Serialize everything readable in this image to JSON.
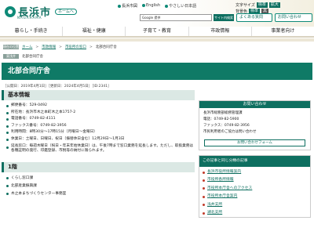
{
  "header": {
    "site_name": "長浜市",
    "site_sub": "NAGAHAMA",
    "home_label": "ホームへ",
    "top_links": [
      "長浜市図",
      "English",
      "やさしい日本語"
    ],
    "text_size_label": "文字サイズ",
    "size_buttons": [
      "標準",
      "拡大"
    ],
    "color_label": "背景色",
    "color_buttons": [
      "標準",
      "黒"
    ],
    "search_placeholder": "Google 提供",
    "search_button": "サイト内検索",
    "faq_button": "よくある質問",
    "contact_button": "お問い合わせ"
  },
  "nav": {
    "items": [
      "暮らし・手続き",
      "福祉・健康",
      "子育て・教育",
      "市政情報",
      "事業者向け"
    ]
  },
  "breadcrumb": {
    "tag": "現在の位置",
    "items": [
      "ホーム",
      "市政情報",
      "市役所の窓口",
      "北部合同庁舎"
    ],
    "tag2": "東浅井",
    "items2": [
      "北部合同庁舎"
    ]
  },
  "title": "北部合同庁舎",
  "meta": "［公開日：2019年4月1日］［更新日：2024年4月5日］［ID:2341］",
  "basic": {
    "heading": "基本情報",
    "items": [
      "郵便番号：529-0492",
      "所在地：長浜市木之本町木之本1757-2",
      "電話番号：0749-82-4111",
      "ファックス番号：0749-82-3956",
      "利用時間：8時30分～17時15分（月曜日～金曜日）",
      "休業日：土曜日、日曜日、祝日（振替休日含む）12月29日～1月3日",
      "延長窓口：毎週木曜日（祝日・年末年始休業日）は、午後7時まで窓口業務を延長します。ただし、取扱業務は各種証明の発行、印鑑登録、市税等の納付に限られます。"
    ]
  },
  "floor1": {
    "heading": "1階",
    "items": [
      "くらし窓口課",
      "北部産業振興課",
      "木之本まちづくりセンター事務室"
    ]
  },
  "contact": {
    "heading": "お問い合わせ",
    "lines": [
      "長浜市総務部総務管理課",
      "電話：0749-82-5900",
      "ファックス：0749-82-3956",
      "市民利用者のご協力は問い合わせ"
    ],
    "form_label": "お問い合わせフォーム"
  },
  "related": {
    "heading": "この記事と同じ分類の記事",
    "items": [
      "長浜市役所情報案内",
      "市役所各所情報",
      "市役所本庁舎へのアクセス",
      "市役所本庁舎案内",
      "浅井支所",
      "湖北支所"
    ]
  }
}
